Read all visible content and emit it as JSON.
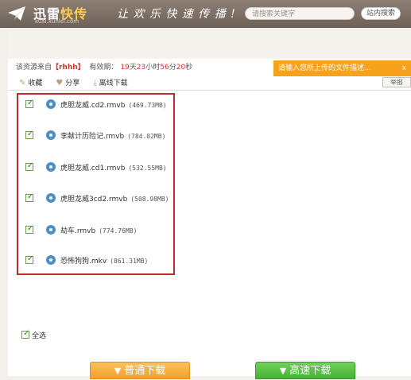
{
  "header": {
    "brand_part1": "迅雷",
    "brand_part2": "快传",
    "brand_url": "kuai.xunlei.com",
    "slogan": "让 欢 乐 快 速 传 播 !",
    "search_placeholder": "请搜索关键字",
    "search_button": "站内搜索"
  },
  "info": {
    "source_prefix": "该资源来自",
    "source_user": "【rhhh】",
    "validity_label": "有效期：",
    "days": "19",
    "days_unit": "天",
    "hours": "23",
    "hours_unit": "小时",
    "minutes": "56",
    "minutes_unit": "分",
    "seconds": "20",
    "seconds_unit": "秒"
  },
  "notice": {
    "text": "请输入您所上传的文件描述...",
    "close": "x"
  },
  "actions": {
    "favorite": "收藏",
    "share": "分享",
    "offline": "离线下载",
    "report": "举报"
  },
  "files": [
    {
      "name": "虎胆龙威.cd2.rmvb",
      "size": "(469.73MB)",
      "checked": true
    },
    {
      "name": "李献计历险记.rmvb",
      "size": "(784.02MB)",
      "checked": true
    },
    {
      "name": "虎胆龙威.cd1.rmvb",
      "size": "(532.55MB)",
      "checked": true
    },
    {
      "name": "虎胆龙威3cd2.rmvb",
      "size": "(508.98MB)",
      "checked": true
    },
    {
      "name": "劫车.rmvb",
      "size": "(774.76MB)",
      "checked": true
    },
    {
      "name": "恐怖狗狗.mkv",
      "size": "(861.31MB)",
      "checked": true
    }
  ],
  "select_all": "全选",
  "buttons": {
    "normal_download": "普通下载",
    "fast_download": "高速下载"
  },
  "colors": {
    "header": "#7a6d63",
    "accent_orange": "#f6a21c",
    "accent_green": "#45b335",
    "highlight_red": "#c0282b"
  }
}
